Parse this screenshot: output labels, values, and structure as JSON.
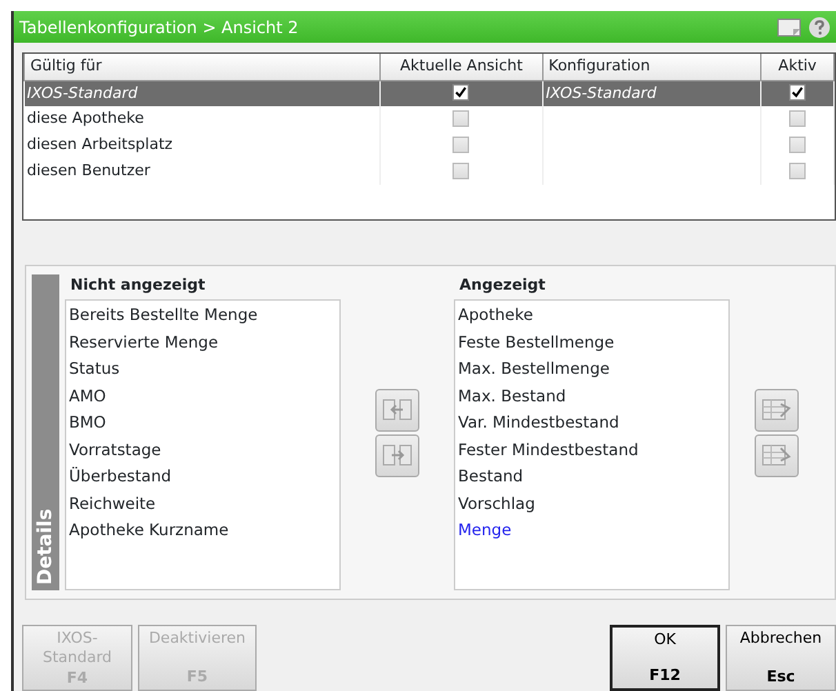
{
  "window": {
    "title": "Tabellenkonfiguration > Ansicht 2"
  },
  "table": {
    "columns": [
      "Gültig für",
      "Aktuelle Ansicht",
      "Konfiguration",
      "Aktiv"
    ],
    "rows": [
      {
        "scope": "IXOS-Standard",
        "current_view": true,
        "configuration": "IXOS-Standard",
        "active": true,
        "selected": true
      },
      {
        "scope": "diese Apotheke",
        "current_view": false,
        "active": false,
        "selected": false
      },
      {
        "scope": "diesen Arbeitsplatz",
        "current_view": false,
        "active": false,
        "selected": false
      },
      {
        "scope": "diesen Benutzer",
        "current_view": false,
        "active": false,
        "selected": false
      }
    ]
  },
  "details": {
    "label": "Details",
    "hidden_list": {
      "title": "Nicht angezeigt",
      "items": [
        {
          "label": "Bereits Bestellte Menge",
          "selected": false
        },
        {
          "label": "Reservierte Menge",
          "selected": false
        },
        {
          "label": "Status",
          "selected": false
        },
        {
          "label": "AMO",
          "selected": false
        },
        {
          "label": "BMO",
          "selected": false
        },
        {
          "label": "Vorratstage",
          "selected": false
        },
        {
          "label": "Überbestand",
          "selected": false
        },
        {
          "label": "Reichweite",
          "selected": false
        },
        {
          "label": "Apotheke Kurzname",
          "selected": false
        }
      ]
    },
    "shown_list": {
      "title": "Angezeigt",
      "items": [
        {
          "label": "Apotheke",
          "selected": false
        },
        {
          "label": "Feste Bestellmenge",
          "selected": false
        },
        {
          "label": "Max. Bestellmenge",
          "selected": false
        },
        {
          "label": "Max. Bestand",
          "selected": false
        },
        {
          "label": "Var. Mindestbestand",
          "selected": false
        },
        {
          "label": "Fester Mindestbestand",
          "selected": false
        },
        {
          "label": "Bestand",
          "selected": false
        },
        {
          "label": "Vorschlag",
          "selected": false
        },
        {
          "label": "Menge",
          "selected": true
        }
      ]
    }
  },
  "footer_buttons": [
    {
      "label": "IXOS-Standard",
      "key": "F4",
      "disabled": true,
      "default": false
    },
    {
      "label": "Deaktivieren",
      "key": "F5",
      "disabled": true,
      "default": false
    },
    {
      "label": "OK",
      "key": "F12",
      "disabled": false,
      "default": true
    },
    {
      "label": "Abbrechen",
      "key": "Esc",
      "disabled": false,
      "default": false
    }
  ]
}
